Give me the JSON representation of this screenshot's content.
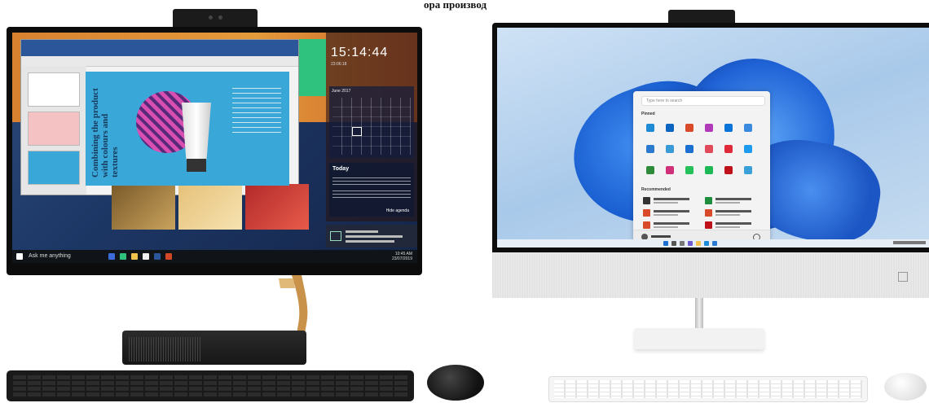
{
  "caption": {
    "text": "ора производ"
  },
  "left_pc": {
    "clock": {
      "time": "15:14:44",
      "date": "23:06:18"
    },
    "calendar": {
      "month_label": "June 2017"
    },
    "today": {
      "heading": "Today",
      "more": "Hide agenda"
    },
    "taskbar": {
      "search_text": "Ask me anything",
      "time": "10:45 AM",
      "date": "23/07/2019"
    },
    "slide_title": "Combining the product with colours and textures"
  },
  "right_pc": {
    "start_menu": {
      "search_placeholder": "Type here to search",
      "pinned_label": "Pinned",
      "recommended_label": "Recommended"
    }
  },
  "colors": {
    "left_wallpaper": "#1c3664",
    "left_accent_orange": "#e59a3a",
    "right_wallpaper": "#a9c9ea",
    "bloom_blue": "#1a5fd1",
    "gold_arm": "#c8924a"
  }
}
